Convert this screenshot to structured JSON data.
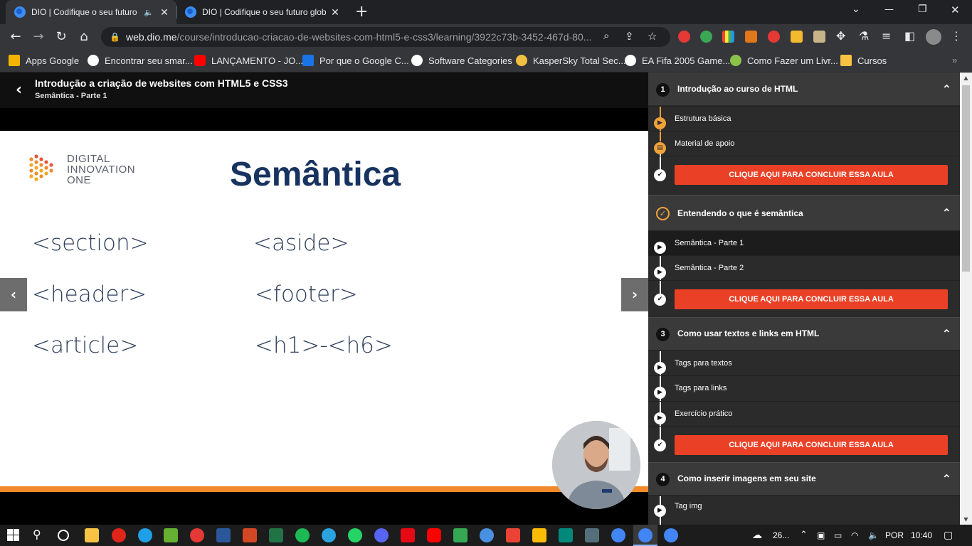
{
  "browser": {
    "tabs": [
      {
        "title": "DIO | Codifique o seu futuro",
        "close": "✕",
        "mute_icon": "speaker-icon"
      },
      {
        "title": "DIO | Codifique o seu futuro glob",
        "close": "✕"
      }
    ],
    "new_tab": "+",
    "window_controls": {
      "dropdown": "⌄",
      "minimize": "—",
      "restore": "❐",
      "close": "✕"
    },
    "url_host": "web.dio.me",
    "url_path": "/course/introducao-criacao-de-websites-com-html5-e-css3/learning/3922c73b-3452-467d-80...",
    "bookmarks": [
      {
        "label": "Apps Google",
        "icon_color": "#f4b400"
      },
      {
        "label": "Encontrar seu smar...",
        "icon_color": "#ffffff"
      },
      {
        "label": "LANÇAMENTO - JO...",
        "icon_color": "#ff0000"
      },
      {
        "label": "Por que o Google C...",
        "icon_color": "#1a73e8"
      },
      {
        "label": "Software Categories",
        "icon_color": "#ffffff"
      },
      {
        "label": "KasperSky Total Sec...",
        "icon_color": "#f0c040"
      },
      {
        "label": "EA Fifa 2005 Game...",
        "icon_color": "#ffffff"
      },
      {
        "label": "Como Fazer um Livr...",
        "icon_color": "#8bc34a"
      },
      {
        "label": "Cursos",
        "icon_color": "#f6c343"
      }
    ],
    "more_bookmarks": "»"
  },
  "course": {
    "title": "Introdução a criação de websites com HTML5 e CSS3",
    "subtitle": "Semântica - Parte 1"
  },
  "slide": {
    "logo_lines": [
      "DIGITAL",
      "INNOVATION",
      "ONE"
    ],
    "title": "Semântica",
    "tags_left": [
      "<section>",
      "<header>",
      "<article>"
    ],
    "tags_right": [
      "<aside>",
      "<footer>",
      "<h1>-<h6>"
    ]
  },
  "sidebar": {
    "complete_label": "CLIQUE AQUI PARA CONCLUIR ESSA AULA",
    "modules": [
      {
        "number": "1",
        "title": "Introdução ao curso de HTML",
        "lessons": [
          "Estrutura básica",
          "Material de apoio"
        ]
      },
      {
        "number": "",
        "title": "Entendendo o que é semântica",
        "lessons": [
          "Semântica - Parte 1",
          "Semântica - Parte 2"
        ]
      },
      {
        "number": "3",
        "title": "Como usar textos e links em HTML",
        "lessons": [
          "Tags para textos",
          "Tags para links",
          "Exercício prático"
        ]
      },
      {
        "number": "4",
        "title": "Como inserir imagens em seu site",
        "lessons": [
          "Tag img"
        ]
      }
    ]
  },
  "taskbar": {
    "weather": "26...",
    "language": "POR",
    "time": "10:40"
  },
  "colors": {
    "accent_orange": "#f08a2a",
    "complete_red": "#ea4126",
    "slide_title_navy": "#17335f"
  }
}
